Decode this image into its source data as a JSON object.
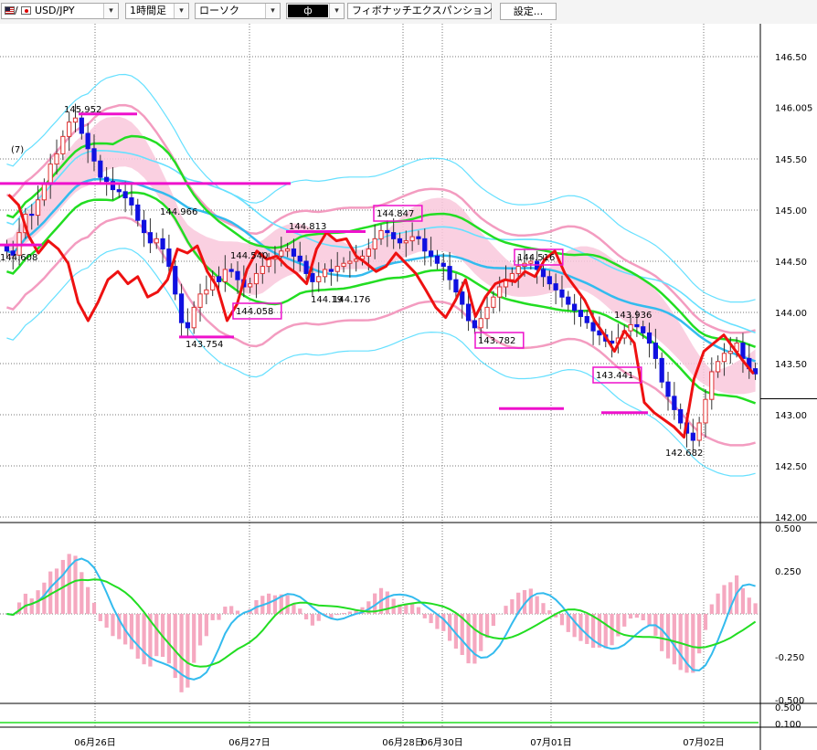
{
  "toolbar": {
    "pair": "USD/JPY",
    "pair_separator": "/",
    "timeframe": "1時間足",
    "chart_type": "ローソク",
    "indicator_marker": "ф",
    "indicator": "フィボナッチエクスパンション",
    "settings": "設定..."
  },
  "colors": {
    "up_candle": "#e03030",
    "down_candle": "#1010e0",
    "fast_line": "#ee1111",
    "mid_line": "#22dd22",
    "slow_line": "#33bbee",
    "bands": "#f39cc0",
    "outer_band": "#66e0ff",
    "cloud": "#f9c8dc",
    "marker": "#ee11cc"
  },
  "chart_data": [
    {
      "type": "candlestick",
      "ylim": [
        142.0,
        146.5
      ],
      "y_ticks": [
        "146.50",
        "146.005",
        "145.50",
        "145.00",
        "144.50",
        "144.00",
        "143.50",
        "143.00",
        "142.50",
        "142.00"
      ],
      "x_ticks": [
        "06月26日",
        "06月27日",
        "06月28日",
        "06月30日",
        "07月01日",
        "07月02日"
      ],
      "annotations": [
        "145.952",
        "144.966",
        "144.813",
        "144.847",
        "144.540",
        "144.608",
        "144.058",
        "143.754",
        "144.19",
        "144.176",
        "143.782",
        "144.516",
        "143.936",
        "143.441",
        "142.682",
        "(7)"
      ],
      "boxed_labels": [
        "144.847",
        "144.058",
        "143.782",
        "144.516",
        "143.441"
      ],
      "key_levels": [
        {
          "label": "145.952",
          "value": 145.94
        },
        {
          "label": "144.966",
          "value": 144.66
        },
        {
          "label": "(7)",
          "value": 145.26
        },
        {
          "label": "144.813",
          "value": 144.79
        },
        {
          "label": "143.754",
          "value": 143.76
        },
        {
          "label": "143.782",
          "value": 143.06
        },
        {
          "label": "143.441",
          "value": 143.02
        }
      ],
      "close_series": [
        144.6,
        144.56,
        144.78,
        144.96,
        144.95,
        145.1,
        145.25,
        145.45,
        145.55,
        145.72,
        145.86,
        145.9,
        145.75,
        145.6,
        145.48,
        145.32,
        145.28,
        145.2,
        145.18,
        145.12,
        145.05,
        144.9,
        144.78,
        144.68,
        144.72,
        144.62,
        144.45,
        144.18,
        143.9,
        143.85,
        144.05,
        144.18,
        144.22,
        144.35,
        144.3,
        144.42,
        144.4,
        144.32,
        144.25,
        144.28,
        144.38,
        144.45,
        144.52,
        144.55,
        144.6,
        144.62,
        144.55,
        144.5,
        144.38,
        144.3,
        144.35,
        144.42,
        144.4,
        144.45,
        144.48,
        144.5,
        144.52,
        144.55,
        144.62,
        144.72,
        144.8,
        144.78,
        144.72,
        144.68,
        144.7,
        144.74,
        144.72,
        144.6,
        144.55,
        144.48,
        144.45,
        144.32,
        144.2,
        144.08,
        143.92,
        143.85,
        143.94,
        144.05,
        144.15,
        144.25,
        144.32,
        144.38,
        144.45,
        144.48,
        144.5,
        144.42,
        144.35,
        144.28,
        144.22,
        144.15,
        144.08,
        144.02,
        143.96,
        143.9,
        143.82,
        143.78,
        143.72,
        143.7,
        143.75,
        143.82,
        143.88,
        143.86,
        143.8,
        143.7,
        143.55,
        143.32,
        143.18,
        143.05,
        142.92,
        142.82,
        142.75,
        142.92,
        143.15,
        143.42,
        143.52,
        143.6,
        143.62,
        143.7,
        143.55,
        143.45,
        143.4
      ],
      "series": [
        {
          "name": "signal_red",
          "values": [
            145.15,
            145.05,
            144.75,
            144.58,
            144.7,
            144.62,
            144.48,
            144.1,
            143.92,
            144.1,
            144.32,
            144.4,
            144.28,
            144.35,
            144.15,
            144.2,
            144.32,
            144.62,
            144.58,
            144.65,
            144.4,
            144.25,
            143.92,
            144.08,
            144.42,
            144.6,
            144.52,
            144.55,
            144.45,
            144.38,
            144.28,
            144.62,
            144.78,
            144.7,
            144.72,
            144.55,
            144.48,
            144.4,
            144.45,
            144.58,
            144.48,
            144.38,
            144.22,
            144.05,
            143.95,
            144.12,
            144.32,
            143.96,
            144.15,
            144.28,
            144.32,
            144.3,
            144.4,
            144.35,
            144.52,
            144.6,
            144.38,
            144.25,
            144.12,
            143.92,
            143.78,
            143.62,
            143.82,
            143.7,
            143.12,
            143.02,
            142.95,
            142.88,
            142.78,
            143.35,
            143.62,
            143.7,
            143.78,
            143.65,
            143.52,
            143.4
          ]
        }
      ],
      "volume_panel": {
        "ylim": [
          -0.5,
          0.5
        ],
        "y_ticks": [
          "0.500",
          "0.250",
          "-0.250",
          "-0.500"
        ]
      },
      "bottom_strip": {
        "y_ticks": [
          "0.500",
          "0.100"
        ]
      }
    }
  ]
}
